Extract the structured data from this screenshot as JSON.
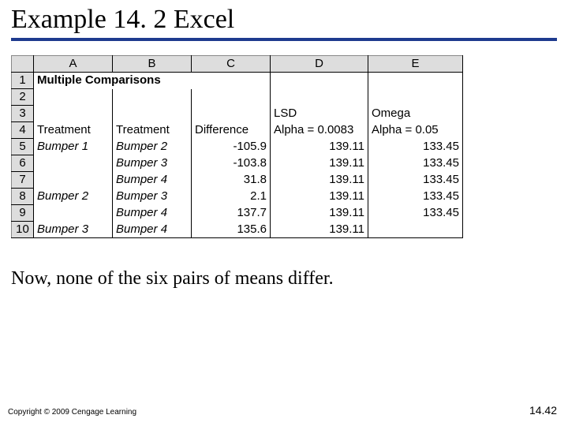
{
  "title": "Example 14. 2 Excel",
  "caption": "Now, none of the six pairs of means differ.",
  "copyright": "Copyright © 2009 Cengage Learning",
  "pagenum": "14.42",
  "chart_data": {
    "type": "table",
    "columns": [
      "A",
      "B",
      "C",
      "D",
      "E"
    ],
    "row_labels": [
      "1",
      "2",
      "3",
      "4",
      "5",
      "6",
      "7",
      "8",
      "9",
      "10"
    ],
    "header_row1": {
      "A": "Multiple Comparisons"
    },
    "header_row3": {
      "D": "LSD",
      "E": "Omega"
    },
    "header_row4": {
      "A": "Treatment",
      "B": "Treatment",
      "C": "Difference",
      "D": "Alpha = 0.0083",
      "E": "Alpha = 0.05"
    },
    "data": [
      {
        "A": "Bumper 1",
        "B": "Bumper 2",
        "C": -105.9,
        "D": 139.11,
        "E": 133.45
      },
      {
        "A": "",
        "B": "Bumper 3",
        "C": -103.8,
        "D": 139.11,
        "E": 133.45
      },
      {
        "A": "",
        "B": "Bumper 4",
        "C": 31.8,
        "D": 139.11,
        "E": 133.45
      },
      {
        "A": "Bumper 2",
        "B": "Bumper 3",
        "C": 2.1,
        "D": 139.11,
        "E": 133.45
      },
      {
        "A": "",
        "B": "Bumper 4",
        "C": 137.7,
        "D": 139.11,
        "E": 133.45
      },
      {
        "A": "Bumper 3",
        "B": "Bumper 4",
        "C": 135.6,
        "D": 139.11,
        "E": ""
      }
    ]
  },
  "cols": {
    "A": "A",
    "B": "B",
    "C": "C",
    "D": "D",
    "E": "E"
  },
  "rows": {
    "r1": "1",
    "r2": "2",
    "r3": "3",
    "r4": "4",
    "r5": "5",
    "r6": "6",
    "r7": "7",
    "r8": "8",
    "r9": "9",
    "r10": "10"
  },
  "cell": {
    "A1": "Multiple Comparisons",
    "D3": "LSD",
    "E3": "Omega",
    "A4": "Treatment",
    "B4": "Treatment",
    "C4": "Difference",
    "D4": "Alpha = 0.0083",
    "E4": "Alpha = 0.05",
    "A5": "Bumper 1",
    "B5": "Bumper 2",
    "C5": "-105.9",
    "D5": "139.11",
    "E5": "133.45",
    "B6": "Bumper 3",
    "C6": "-103.8",
    "D6": "139.11",
    "E6": "133.45",
    "B7": "Bumper 4",
    "C7": "31.8",
    "D7": "139.11",
    "E7": "133.45",
    "A8": "Bumper 2",
    "B8": "Bumper 3",
    "C8": "2.1",
    "D8": "139.11",
    "E8": "133.45",
    "B9": "Bumper 4",
    "C9": "137.7",
    "D9": "139.11",
    "E9": "133.45",
    "A10": "Bumper 3",
    "B10": "Bumper 4",
    "C10": "135.6",
    "D10": "139.11"
  }
}
